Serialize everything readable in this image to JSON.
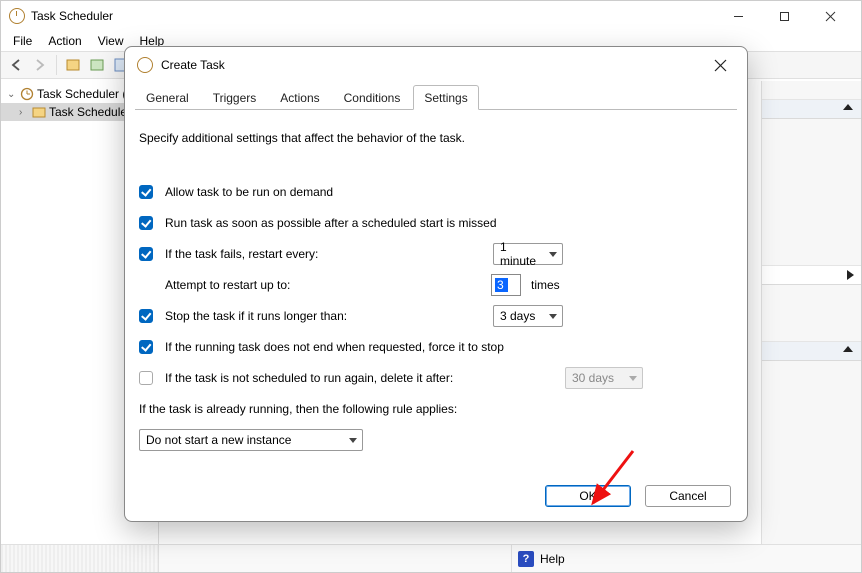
{
  "mainWindow": {
    "title": "Task Scheduler",
    "menu": {
      "file": "File",
      "action": "Action",
      "view": "View",
      "help": "Help"
    },
    "tree": {
      "root": "Task Scheduler (L",
      "child": "Task Schedule"
    },
    "statusbar": {
      "help": "Help"
    }
  },
  "dialog": {
    "title": "Create Task",
    "tabs": {
      "general": "General",
      "triggers": "Triggers",
      "actions": "Actions",
      "conditions": "Conditions",
      "settings": "Settings"
    },
    "settingsPanel": {
      "intro": "Specify additional settings that affect the behavior of the task.",
      "allowOnDemand": "Allow task to be run on demand",
      "runAsap": "Run task as soon as possible after a scheduled start is missed",
      "restartEvery": "If the task fails, restart every:",
      "restartInterval": "1 minute",
      "attemptUpTo": "Attempt to restart up to:",
      "attemptCount": "3",
      "timesSuffix": "times",
      "stopIfLonger": "Stop the task if it runs longer than:",
      "stopDuration": "3 days",
      "forceStop": "If the running task does not end when requested, force it to stop",
      "deleteAfter": "If the task is not scheduled to run again, delete it after:",
      "deleteAfterDuration": "30 days",
      "ruleApplies": "If the task is already running, then the following rule applies:",
      "ruleValue": "Do not start a new instance"
    },
    "buttons": {
      "ok": "OK",
      "cancel": "Cancel"
    }
  }
}
